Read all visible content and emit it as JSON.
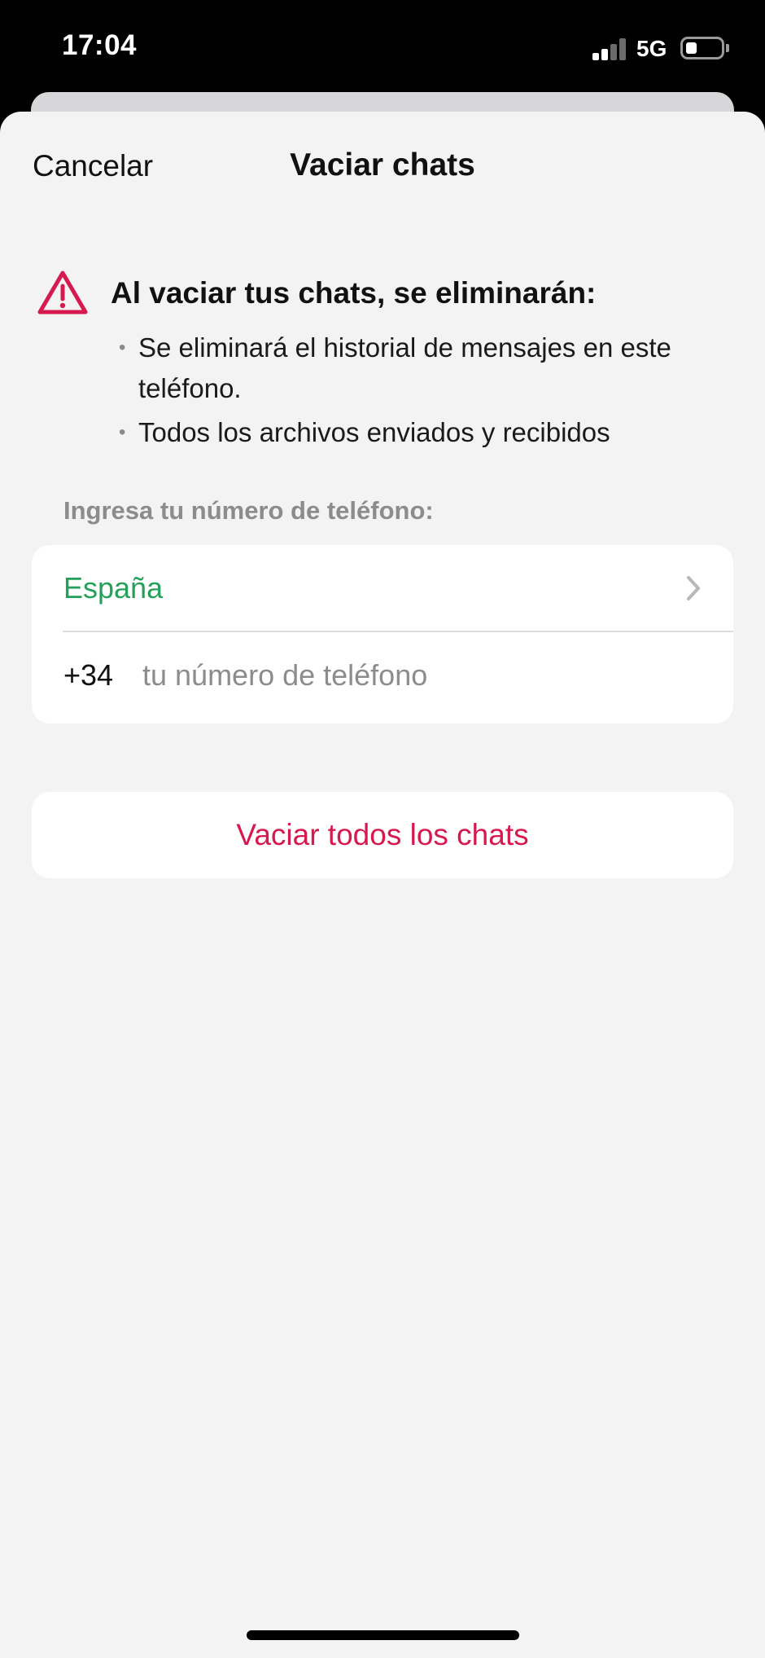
{
  "status_bar": {
    "time": "17:04",
    "network": "5G",
    "signal_bars_active": 2,
    "signal_bars_total": 4,
    "battery_level_fraction": 0.25
  },
  "nav": {
    "cancel_label": "Cancelar",
    "title": "Vaciar chats"
  },
  "warning": {
    "icon": "warning-triangle-icon",
    "heading": "Al vaciar tus chats, se eliminarán:",
    "items": [
      "Se eliminará el historial de mensajes en este teléfono.",
      "Todos los archivos enviados y recibidos"
    ]
  },
  "phone_form": {
    "label": "Ingresa tu número de teléfono:",
    "country": "España",
    "country_code": "+34",
    "phone_value": "",
    "phone_placeholder": "tu número de teléfono"
  },
  "actions": {
    "clear_all_label": "Vaciar todos los chats"
  },
  "colors": {
    "accent_green": "#25a05a",
    "destructive_red": "#d6194f",
    "background": "#f3f3f3",
    "card": "#ffffff"
  }
}
